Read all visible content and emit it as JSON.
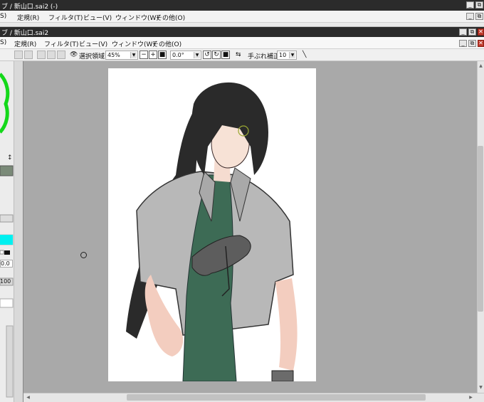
{
  "outer_window": {
    "title": "ブ / 新山口.sai2 (-)",
    "menu": [
      "S)",
      "定規(R)",
      "フィルタ(T)",
      "ビュー(V)",
      "ウィンドウ(W)",
      "その他(O)"
    ]
  },
  "inner_window": {
    "title": "ブ / 新山口.sai2",
    "menu": [
      "S)",
      "定規(R)",
      "フィルタ(T)",
      "ビュー(V)",
      "ウィンドウ(W)",
      "その他(O)"
    ]
  },
  "window_controls": {
    "minimize": "_",
    "restore": "⧉",
    "close": "✕"
  },
  "canvas_toolbar": {
    "selection_label": "選択領域",
    "zoom": "45%",
    "rotation": "0.0°",
    "stabilizer_label": "手ぶれ補正",
    "stabilizer_value": "10"
  },
  "left_panel": {
    "opacity_value": "0.0",
    "size_value": "100",
    "accent_color": "#00f0f0"
  },
  "colors": {
    "titlebar": "#2b2b2b",
    "canvas_bg": "#a9a9a9",
    "paper": "#ffffff",
    "shirt_green": "#3d6b55",
    "jacket_gray": "#b8b8b8",
    "hair": "#2a2a2a"
  }
}
